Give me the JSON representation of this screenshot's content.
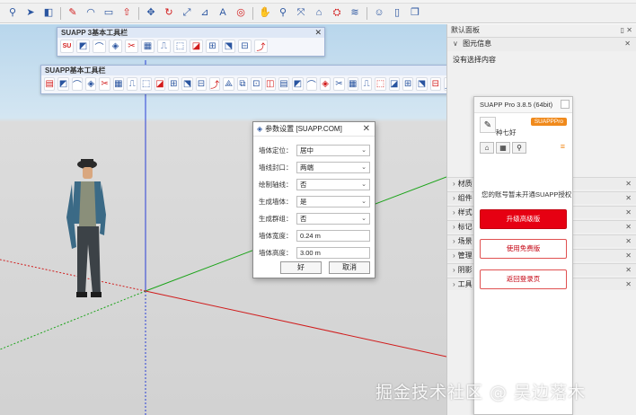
{
  "main_toolbar": {
    "icons": [
      "search-icon",
      "select-arrow-icon",
      "eraser-icon",
      "pencil-icon",
      "arc-icon",
      "rectangle-icon",
      "push-pull-icon",
      "move-icon",
      "rotate-icon",
      "scale-icon",
      "tape-measure-icon",
      "text-icon",
      "orbit-icon",
      "pan-icon",
      "zoom-icon",
      "zoom-extents-icon",
      "warehouse-icon",
      "extension-icon",
      "layer-icon",
      "account-icon",
      "new-doc-icon",
      "copy-icon"
    ]
  },
  "suapp3_toolbar": {
    "title": "SUAPP 3基本工具栏",
    "icon_count": 13,
    "first_icon_label": "SU"
  },
  "suapp_toolbar": {
    "title": "SUAPP基本工具栏",
    "icon_count": 38,
    "last_icon_label": "SU"
  },
  "dialog": {
    "title": "参数设置 [SUAPP.COM]",
    "rows": [
      {
        "label": "墙体定位：",
        "value": "居中",
        "type": "select"
      },
      {
        "label": "墙线封口：",
        "value": "两端",
        "type": "select"
      },
      {
        "label": "绘制轴线：",
        "value": "否",
        "type": "select"
      },
      {
        "label": "生成墙体：",
        "value": "是",
        "type": "select"
      },
      {
        "label": "生成群组：",
        "value": "否",
        "type": "select"
      },
      {
        "label": "墙体宽度：",
        "value": "0.24 m",
        "type": "text"
      },
      {
        "label": "墙体高度：",
        "value": "3.00 m",
        "type": "text"
      }
    ],
    "ok_label": "好",
    "cancel_label": "取消"
  },
  "tray": {
    "title": "默认面板",
    "sections": [
      "图元信息",
      "材质",
      "组件",
      "样式",
      "标记",
      "场景",
      "管理",
      "阴影",
      "工具"
    ],
    "first_section_label": "图元信息",
    "sub_label": "没有选择内容"
  },
  "suapp_panel": {
    "title": "SUAPP Pro 3.8.5 (64bit)",
    "badge": "SUAPPPro",
    "username": "种七好",
    "message": "您的账号暂未开通SUAPP授权",
    "buttons": [
      "升级高级版",
      "使用免费版",
      "返回登录页"
    ]
  },
  "watermark": "掘金技术社区 @ 吴边落木"
}
